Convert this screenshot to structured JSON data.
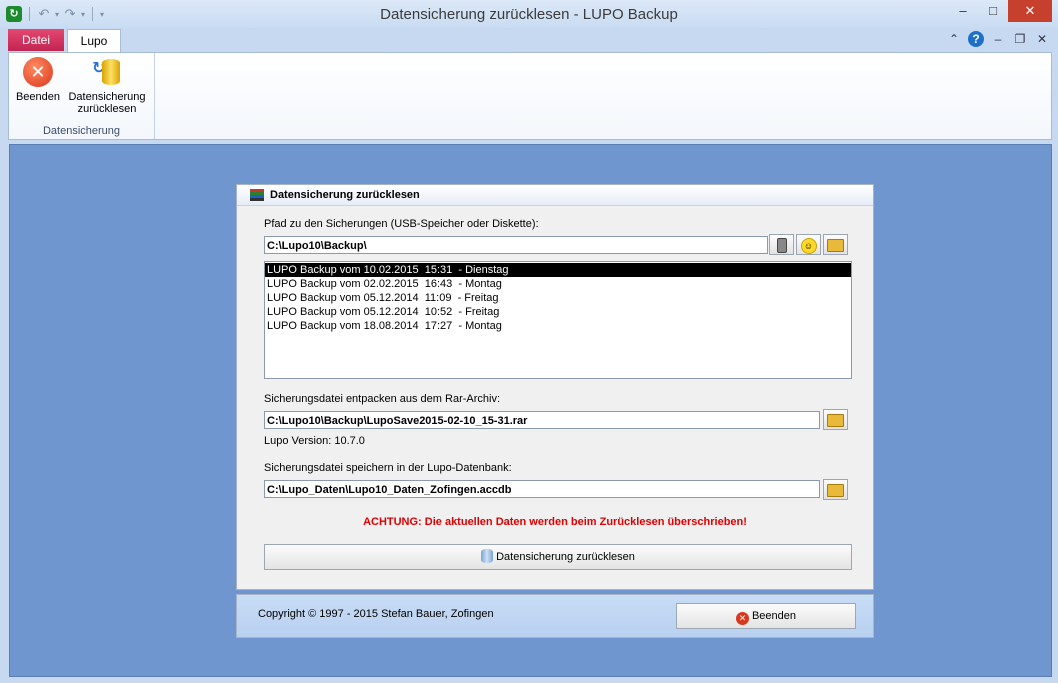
{
  "window": {
    "title": "Datensicherung zurücklesen  -  LUPO Backup",
    "min": "–",
    "max": "□",
    "close": "✕"
  },
  "qat": {
    "app_icon": "↻",
    "undo": "↶",
    "redo": "↷",
    "dropdown": "▾"
  },
  "ribbon": {
    "tabs": [
      "Datei",
      "Lupo"
    ],
    "right_icons": {
      "collapse": "⌃",
      "help": "?",
      "min": "–",
      "restore": "❐",
      "close": "✕"
    },
    "buttons": [
      {
        "label": "Beenden",
        "icon": "x-circle-icon",
        "glyph": "✕"
      },
      {
        "label_line1": "Datensicherung",
        "label_line2": "zurücklesen",
        "icon": "database-restore-icon",
        "glyph": "↻"
      }
    ],
    "group_label": "Datensicherung"
  },
  "panel": {
    "title": "Datensicherung zurücklesen",
    "path_label": "Pfad zu den Sicherungen (USB-Speicher oder Diskette):",
    "path_value": "C:\\Lupo10\\Backup\\",
    "backups": [
      "LUPO Backup vom 10.02.2015  15:31  - Dienstag",
      "LUPO Backup vom 02.02.2015  16:43  - Montag",
      "LUPO Backup vom 05.12.2014  11:09  - Freitag",
      "LUPO Backup vom 05.12.2014  10:52  - Freitag",
      "LUPO Backup vom 18.08.2014  17:27  - Montag"
    ],
    "selected_index": 0,
    "rar_label": "Sicherungsdatei entpacken aus dem Rar-Archiv:",
    "rar_value": "C:\\Lupo10\\Backup\\LupoSave2015-02-10_15-31.rar",
    "version_text": "Lupo Version: 10.7.0",
    "db_label": "Sicherungsdatei speichern in der Lupo-Datenbank:",
    "db_value": "C:\\Lupo_Daten\\Lupo10_Daten_Zofingen.accdb",
    "warning": "ACHTUNG:  Die aktuellen Daten werden beim Zurücklesen überschrieben!",
    "restore_button": "Datensicherung zurücklesen",
    "smile_glyph": "☺"
  },
  "footer": {
    "copyright": "Copyright © 1997 - 2015 Stefan Bauer, Zofingen",
    "exit_button": "Beenden",
    "exit_glyph": "✕"
  },
  "colors": {
    "accent": "#c12552",
    "warning": "#e00000",
    "workspace": "#6f96cf"
  }
}
